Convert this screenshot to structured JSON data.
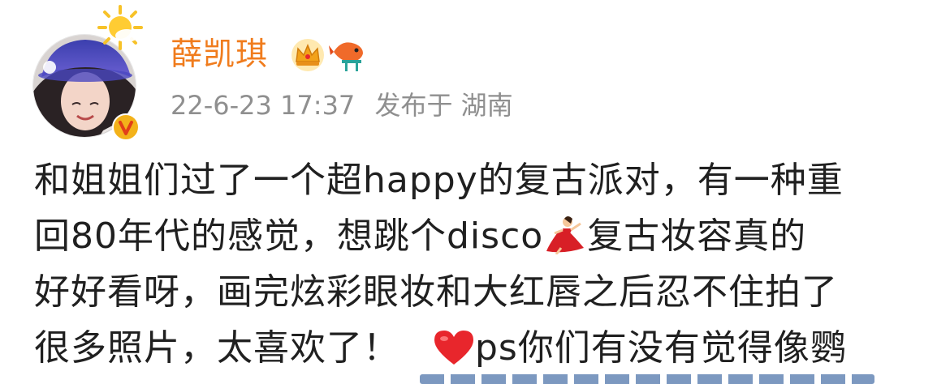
{
  "post": {
    "username": "薛凯琪",
    "timestamp": "22-6-23 17:37",
    "source": "发布于 湖南",
    "badges": [
      "crown-icon",
      "fish-icon",
      "verified-badge",
      "sun-icon"
    ],
    "text_lines": [
      "和姐姐们过了一个超happy的复古派对，有一种重",
      "回80年代的感觉，想跳个disco",
      "复古妆容真的",
      "好好看呀，画完炫彩眼妆和大红唇之后忍不住拍了",
      "很多照片，太喜欢了！",
      "ps你们有没有觉得像鹦"
    ],
    "colors": {
      "username": "#f07c1d",
      "meta": "#8f8f8f",
      "text": "#202020",
      "heart": "#e8262c",
      "link": "#5b7fb0"
    }
  }
}
